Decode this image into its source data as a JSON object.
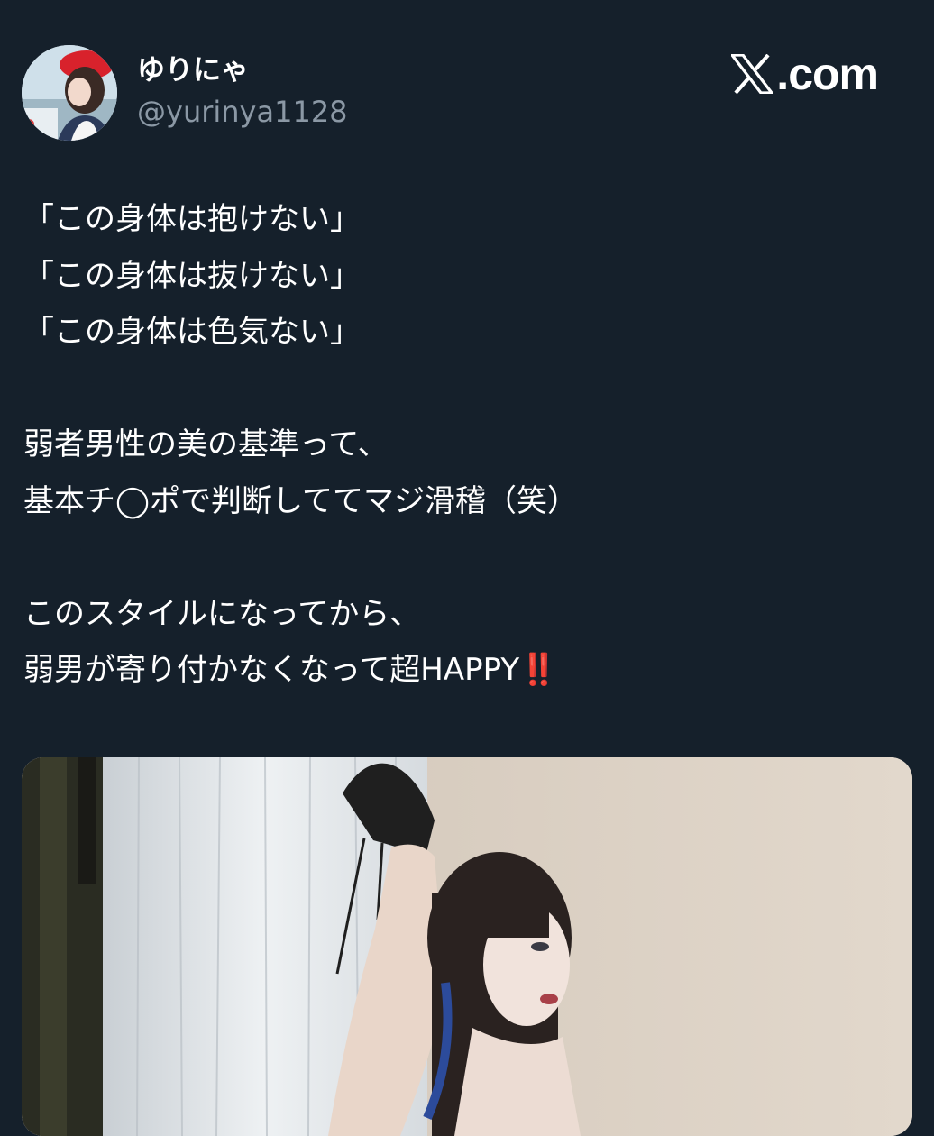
{
  "author": {
    "display_name": "ゆりにゃ",
    "handle": "@yurinya1128",
    "avatar_icon": "avatar-photo"
  },
  "brand": {
    "logo_icon": "x-logo-icon",
    "domain_suffix": ".com"
  },
  "tweet": {
    "lines": [
      "「この身体は抱けない」",
      "「この身体は抜けない」",
      "「この身体は色気ない」",
      "",
      "弱者男性の美の基準って、",
      "基本チ◯ポで判断しててマジ滑稽（笑）",
      "",
      "このスタイルになってから、",
      "弱男が寄り付かなくなって超HAPPY"
    ],
    "trailing_emoji": "‼️"
  },
  "media": {
    "type": "photo"
  },
  "colors": {
    "background": "#15202b",
    "secondary_text": "#8b98a5",
    "emoji_red": "#e0101b"
  }
}
